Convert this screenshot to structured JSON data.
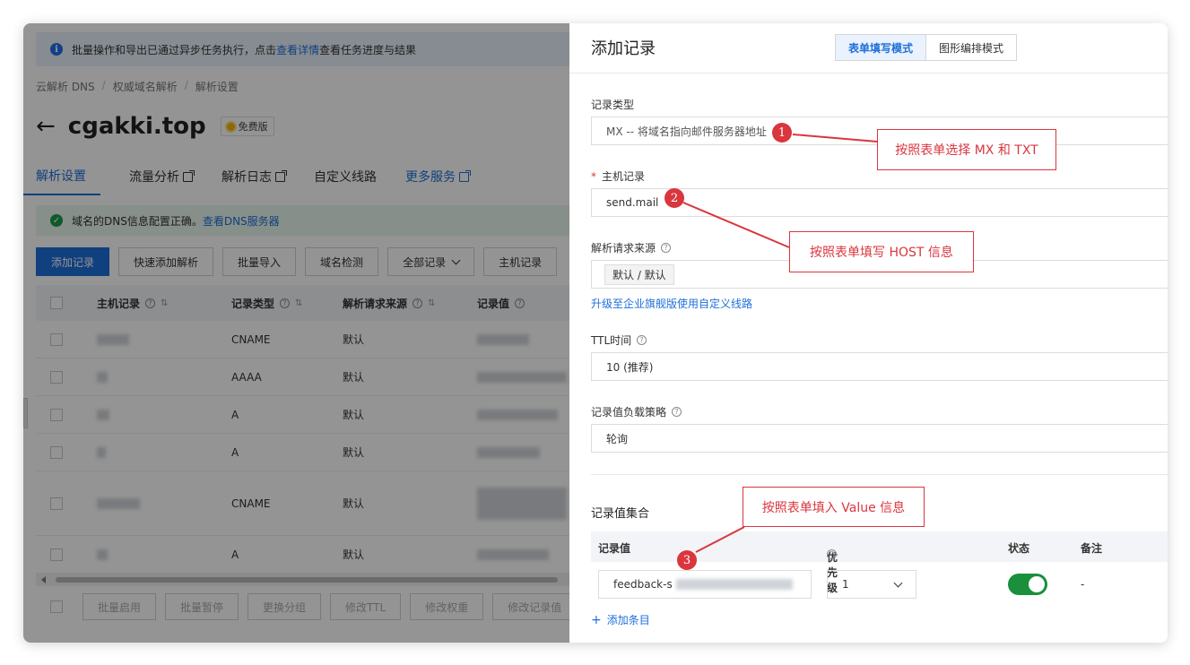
{
  "background": {
    "notice": {
      "text_before": "批量操作和导出已通过异步任务执行，点击",
      "link": "查看详情",
      "text_after": "查看任务进度与结果"
    },
    "breadcrumb": [
      "云解析 DNS",
      "权威域名解析",
      "解析设置"
    ],
    "domain": "cgakki.top",
    "badge": "免费版",
    "tabs": [
      {
        "label": "解析设置"
      },
      {
        "label": "流量分析"
      },
      {
        "label": "解析日志"
      },
      {
        "label": "自定义线路"
      },
      {
        "label": "更多服务"
      }
    ],
    "dns_status": {
      "text": "域名的DNS信息配置正确。",
      "link": "查看DNS服务器"
    },
    "toolbar": {
      "add": "添加记录",
      "quick_add": "快速添加解析",
      "import": "批量导入",
      "check": "域名检测",
      "all_records": "全部记录",
      "host": "主机记录"
    },
    "table": {
      "headers": [
        "主机记录",
        "记录类型",
        "解析请求来源",
        "记录值"
      ],
      "rows": [
        {
          "type": "CNAME",
          "source": "默认"
        },
        {
          "type": "AAAA",
          "source": "默认"
        },
        {
          "type": "A",
          "source": "默认"
        },
        {
          "type": "A",
          "source": "默认"
        },
        {
          "type": "CNAME",
          "source": "默认"
        },
        {
          "type": "A",
          "source": "默认"
        }
      ]
    },
    "bottom_buttons": [
      "批量启用",
      "批量暂停",
      "更换分组",
      "修改TTL",
      "修改权重",
      "修改记录值"
    ]
  },
  "panel": {
    "title": "添加记录",
    "modes": [
      "表单填写模式",
      "图形编排模式"
    ],
    "record_type": {
      "label": "记录类型",
      "value": "MX -- 将域名指向邮件服务器地址"
    },
    "host": {
      "label": "主机记录",
      "required_mark": "*",
      "value": "send.mail"
    },
    "source": {
      "label": "解析请求来源",
      "value": "默认 / 默认"
    },
    "upgrade_link": "升级至企业旗舰版使用自定义线路",
    "ttl": {
      "label": "TTL时间",
      "value": "10 (推荐)"
    },
    "strategy": {
      "label": "记录值负载策略",
      "value": "轮询"
    },
    "value_set": {
      "title": "记录值集合",
      "headers": [
        "记录值",
        "优先级",
        "状态",
        "备注"
      ],
      "row": {
        "value": "feedback-s",
        "priority": "1",
        "enabled": true,
        "remark": "-"
      },
      "add_item": "添加条目"
    }
  },
  "annotations": [
    {
      "step": "1",
      "text": "按照表单选择 MX 和 TXT"
    },
    {
      "step": "2",
      "text": "按照表单填写 HOST 信息"
    },
    {
      "step": "3",
      "text": "按照表单填入 Value 信息"
    }
  ],
  "colors": {
    "accent": "#1e6fd9",
    "annotation": "#d9363e",
    "toggle_on": "#1a8f3c",
    "success": "#1a9c4b"
  }
}
